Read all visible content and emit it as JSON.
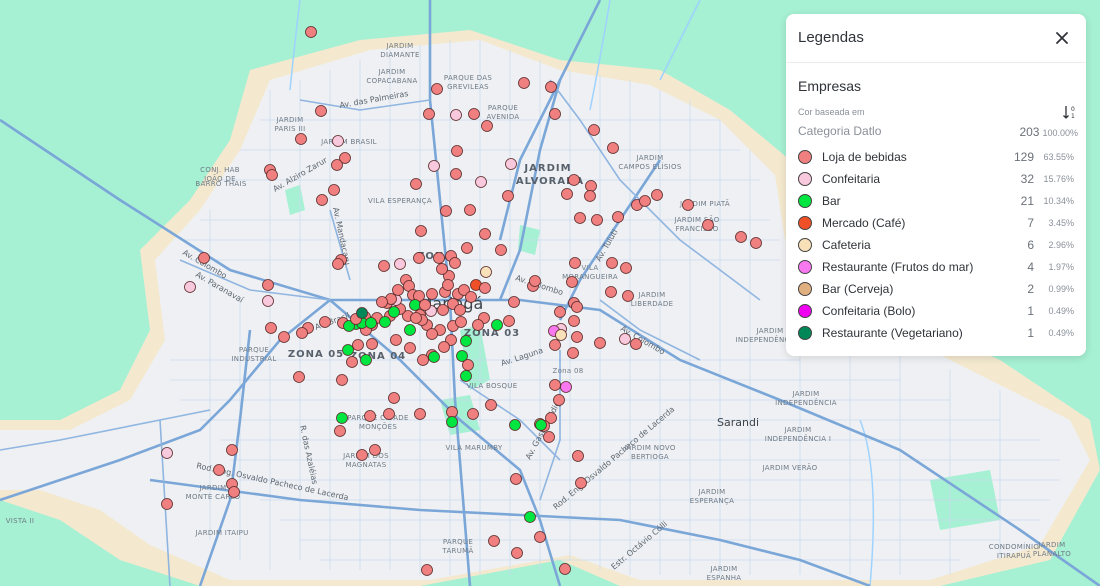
{
  "map": {
    "city_label": "Maringá",
    "town_labels": [
      {
        "id": "sarandi",
        "text": "Sarandi"
      }
    ],
    "zones": [
      {
        "id": "zona",
        "text": "ZONA"
      },
      {
        "id": "zona03",
        "text": "ZONA 03"
      },
      {
        "id": "zona05",
        "text": "ZONA 05"
      },
      {
        "id": "zona04",
        "text": "ZONA 04"
      },
      {
        "id": "zona08",
        "text": "Zona 08"
      },
      {
        "id": "alvorada1",
        "text": "JARDIM"
      },
      {
        "id": "alvorada2",
        "text": "ALVORADA"
      }
    ],
    "neighborhoods": [
      {
        "id": "n1",
        "l1": "JARDIM",
        "l2": "DIAMANTE"
      },
      {
        "id": "n2",
        "l1": "JARDIM",
        "l2": "COPACABANA"
      },
      {
        "id": "n3",
        "l1": "PARQUE DAS",
        "l2": "GREVILEAS"
      },
      {
        "id": "n4",
        "l1": "PARQUE",
        "l2": "AVENIDA"
      },
      {
        "id": "n5",
        "l1": "JARDIM",
        "l2": "PARIS III"
      },
      {
        "id": "n6",
        "l1": "JARDIM BRASIL",
        "l2": ""
      },
      {
        "id": "n7",
        "l1": "CONJ. HAB",
        "l2": "JOÃO DE"
      },
      {
        "id": "n8",
        "l1": "BARRO THAIS",
        "l2": ""
      },
      {
        "id": "n9",
        "l1": "VILA ESPERANÇA",
        "l2": ""
      },
      {
        "id": "n10",
        "l1": "JARDIM",
        "l2": "CAMPOS ELÍSIOS"
      },
      {
        "id": "n11",
        "l1": "JARDIM PIATÃ",
        "l2": ""
      },
      {
        "id": "n12",
        "l1": "JARDIM SÃO",
        "l2": "FRANCISCO"
      },
      {
        "id": "n13",
        "l1": "VILA",
        "l2": "MORANGUEIRA"
      },
      {
        "id": "n14",
        "l1": "JARDIM",
        "l2": "LIBERDADE"
      },
      {
        "id": "n15",
        "l1": "JARDIM",
        "l2": "INDEPENDÊNCIA II"
      },
      {
        "id": "n16",
        "l1": "PARQUE",
        "l2": "INDUSTRIAL"
      },
      {
        "id": "n17",
        "l1": "VILA BOSQUE",
        "l2": ""
      },
      {
        "id": "n18",
        "l1": "PARQUE CIDADE",
        "l2": "MONÇÕES"
      },
      {
        "id": "n19",
        "l1": "VILA MARUMBY",
        "l2": ""
      },
      {
        "id": "n20",
        "l1": "JARDIM DOS",
        "l2": "MAGNATAS"
      },
      {
        "id": "n21",
        "l1": "JARDIM NOVO",
        "l2": "BERTIOGA"
      },
      {
        "id": "n22",
        "l1": "JARDIM",
        "l2": "INDEPENDÊNCIA"
      },
      {
        "id": "n23",
        "l1": "JARDIM",
        "l2": "INDEPENDÊNCIA I"
      },
      {
        "id": "n24",
        "l1": "JARDIM VERÃO",
        "l2": ""
      },
      {
        "id": "n25",
        "l1": "JARDIM",
        "l2": "ESPERANÇA"
      },
      {
        "id": "n26",
        "l1": "JARDIM",
        "l2": "MONTE CARLO"
      },
      {
        "id": "n27",
        "l1": "JARDIM ITAIPU",
        "l2": ""
      },
      {
        "id": "n28",
        "l1": "PARQUE",
        "l2": "TARUMÃ"
      },
      {
        "id": "n29",
        "l1": "JARDIM",
        "l2": "ESPANHA"
      },
      {
        "id": "n30",
        "l1": "CONDOMÍNIO",
        "l2": "ITIRAPUÃ"
      },
      {
        "id": "n31",
        "l1": "JARDIM",
        "l2": "PLANALTO"
      },
      {
        "id": "n32",
        "l1": "VISTA II",
        "l2": ""
      }
    ],
    "roads": [
      {
        "id": "r1",
        "text": "Av. das Palmeiras"
      },
      {
        "id": "r2",
        "text": "Av. Alziro Zarur"
      },
      {
        "id": "r3",
        "text": "Av. Mandacaru"
      },
      {
        "id": "r4",
        "text": "Av. Colombo"
      },
      {
        "id": "r5",
        "text": "Av. Paranavaí"
      },
      {
        "id": "r6",
        "text": "Av. Brasil"
      },
      {
        "id": "r7",
        "text": "Av. Colombo"
      },
      {
        "id": "r8",
        "text": "Av. Tuiuti"
      },
      {
        "id": "r9",
        "text": "Av. Colombo"
      },
      {
        "id": "r10",
        "text": "Av. Laguna"
      },
      {
        "id": "r11",
        "text": "Av. Gastão Vidigal"
      },
      {
        "id": "r12",
        "text": "R. das Azaléias"
      },
      {
        "id": "r13",
        "text": "Rod. Eng. Osvaldo Pacheco de Lacerda"
      },
      {
        "id": "r14",
        "text": "Rod. Eng. Osvaldo Pacheco de Lacerda"
      },
      {
        "id": "r15",
        "text": "Estr. Octávio Cólli"
      }
    ]
  },
  "legend": {
    "title": "Legendas",
    "close_icon": "close-icon",
    "section": "Empresas",
    "based_on": "Cor baseada em",
    "sort_icon": "sort-icon",
    "category_label": "Categoria Datlo",
    "total": "203",
    "total_pct": "100.00%",
    "items": [
      {
        "label": "Loja de bebidas",
        "count": "129",
        "pct": "63.55%",
        "color": "#f08080"
      },
      {
        "label": "Confeitaria",
        "count": "32",
        "pct": "15.76%",
        "color": "#f8c8dc"
      },
      {
        "label": "Bar",
        "count": "21",
        "pct": "10.34%",
        "color": "#00e640"
      },
      {
        "label": "Mercado (Café)",
        "count": "7",
        "pct": "3.45%",
        "color": "#f05028"
      },
      {
        "label": "Cafeteria",
        "count": "6",
        "pct": "2.96%",
        "color": "#f8e0b8"
      },
      {
        "label": "Restaurante (Frutos do mar)",
        "count": "4",
        "pct": "1.97%",
        "color": "#f878f0"
      },
      {
        "label": "Bar (Cerveja)",
        "count": "2",
        "pct": "0.99%",
        "color": "#e0b080"
      },
      {
        "label": "Confeitaria (Bolo)",
        "count": "1",
        "pct": "0.49%",
        "color": "#f000f0"
      },
      {
        "label": "Restaurante (Vegetariano)",
        "count": "1",
        "pct": "0.49%",
        "color": "#008858"
      }
    ]
  }
}
